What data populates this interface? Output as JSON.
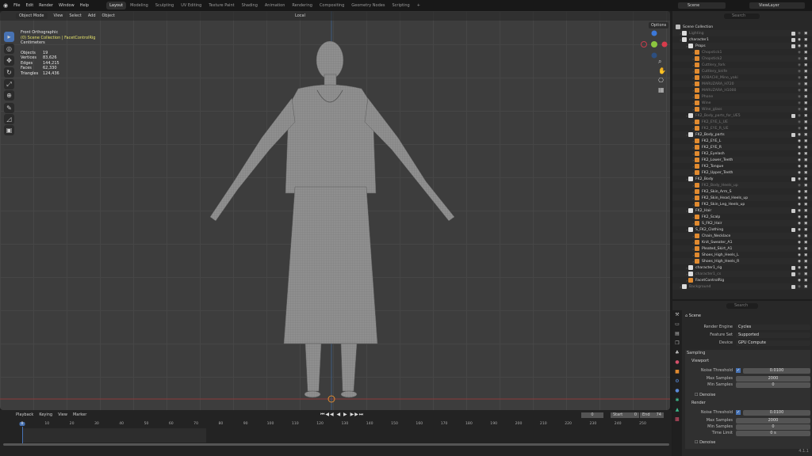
{
  "topbar": {
    "menus": [
      "File",
      "Edit",
      "Render",
      "Window",
      "Help"
    ],
    "workspaces": [
      "Layout",
      "Modeling",
      "Sculpting",
      "UV Editing",
      "Texture Paint",
      "Shading",
      "Animation",
      "Rendering",
      "Compositing",
      "Geometry Nodes",
      "Scripting",
      "+"
    ],
    "active_workspace": "Layout",
    "scene": "Scene",
    "view_layer": "ViewLayer"
  },
  "viewport": {
    "mode": "Object Mode",
    "menus": [
      "View",
      "Select",
      "Add",
      "Object"
    ],
    "transform": "Local",
    "options": "Options",
    "view_name": "Front Orthographic",
    "collection_path": "(0) Scene Collection | FacetControlRig",
    "units": "Centimeters",
    "stats": [
      {
        "label": "Objects",
        "value": "19"
      },
      {
        "label": "Vertices",
        "value": "83,626"
      },
      {
        "label": "Edges",
        "value": "144,215"
      },
      {
        "label": "Faces",
        "value": "62,330"
      },
      {
        "label": "Triangles",
        "value": "124,436"
      }
    ],
    "axes": {
      "x": "X",
      "y": "Y",
      "z": "Z"
    }
  },
  "outliner": {
    "search_placeholder": "Search",
    "rows": [
      {
        "name": "Scene Collection",
        "level": 0,
        "type": "scene",
        "dim": false
      },
      {
        "name": "Lighting",
        "level": 1,
        "type": "collection",
        "dim": true
      },
      {
        "name": "character1",
        "level": 1,
        "type": "collection",
        "dim": false
      },
      {
        "name": "Props",
        "level": 2,
        "type": "collection",
        "dim": false
      },
      {
        "name": "Chopstick1",
        "level": 3,
        "type": "mesh",
        "dim": true
      },
      {
        "name": "Chopstick2",
        "level": 3,
        "type": "mesh",
        "dim": true
      },
      {
        "name": "Cuttlery_fork",
        "level": 3,
        "type": "mesh",
        "dim": true
      },
      {
        "name": "Cuttlery_knife",
        "level": 3,
        "type": "mesh",
        "dim": true
      },
      {
        "name": "KOBACHI_Mino_yaki",
        "level": 3,
        "type": "mesh",
        "dim": true
      },
      {
        "name": "MARUZARA_H720",
        "level": 3,
        "type": "mesh",
        "dim": true
      },
      {
        "name": "MARUZARA_H1000",
        "level": 3,
        "type": "mesh",
        "dim": true
      },
      {
        "name": "Phone",
        "level": 3,
        "type": "mesh",
        "dim": true
      },
      {
        "name": "Wine",
        "level": 3,
        "type": "mesh",
        "dim": true
      },
      {
        "name": "Wine_glass",
        "level": 3,
        "type": "mesh",
        "dim": true
      },
      {
        "name": "FK2_Body_parts_for_UE5",
        "level": 2,
        "type": "collection",
        "dim": true
      },
      {
        "name": "FK2_EYE_L_UE",
        "level": 3,
        "type": "mesh",
        "dim": true
      },
      {
        "name": "FK2_EYE_R_UE",
        "level": 3,
        "type": "mesh",
        "dim": true
      },
      {
        "name": "FK2_Body_parts",
        "level": 2,
        "type": "collection",
        "dim": false
      },
      {
        "name": "FK2_EYE_L",
        "level": 3,
        "type": "mesh",
        "dim": false
      },
      {
        "name": "FK2_EYE_R",
        "level": 3,
        "type": "mesh",
        "dim": false
      },
      {
        "name": "FK2_Eyelash",
        "level": 3,
        "type": "mesh",
        "dim": false
      },
      {
        "name": "FK2_Lower_Teeth",
        "level": 3,
        "type": "mesh",
        "dim": false
      },
      {
        "name": "FK2_Tongue",
        "level": 3,
        "type": "mesh",
        "dim": false
      },
      {
        "name": "FK2_Upper_Teeth",
        "level": 3,
        "type": "mesh",
        "dim": false
      },
      {
        "name": "FK2_Body",
        "level": 2,
        "type": "collection",
        "dim": false
      },
      {
        "name": "FK2_Body_Heels_up",
        "level": 3,
        "type": "mesh",
        "dim": true
      },
      {
        "name": "FK2_Skin_Arm_S",
        "level": 3,
        "type": "mesh",
        "dim": false
      },
      {
        "name": "FK2_Skin_Head_Heels_up",
        "level": 3,
        "type": "mesh",
        "dim": false
      },
      {
        "name": "FK2_Skin_Leg_Heels_up",
        "level": 3,
        "type": "mesh",
        "dim": false
      },
      {
        "name": "FK2_Hair",
        "level": 2,
        "type": "collection",
        "dim": false
      },
      {
        "name": "FK2_Scalp",
        "level": 3,
        "type": "mesh",
        "dim": false
      },
      {
        "name": "S_FK2_Hair",
        "level": 3,
        "type": "mesh",
        "dim": false
      },
      {
        "name": "S_FK2_Clothing",
        "level": 2,
        "type": "collection",
        "dim": false
      },
      {
        "name": "Chain_Necklace",
        "level": 3,
        "type": "mesh",
        "dim": false
      },
      {
        "name": "Knit_Sweater_A1",
        "level": 3,
        "type": "mesh",
        "dim": false
      },
      {
        "name": "Pleated_Skirt_A1",
        "level": 3,
        "type": "mesh",
        "dim": false
      },
      {
        "name": "Shoes_High_Heels_L",
        "level": 3,
        "type": "mesh",
        "dim": false
      },
      {
        "name": "Shoes_High_Heels_R",
        "level": 3,
        "type": "mesh",
        "dim": false
      },
      {
        "name": "character1_rig",
        "level": 2,
        "type": "collection",
        "dim": false
      },
      {
        "name": "character1_cs",
        "level": 2,
        "type": "collection",
        "dim": true
      },
      {
        "name": "FacetControlRig",
        "level": 2,
        "type": "armature",
        "dim": false
      },
      {
        "name": "Background",
        "level": 1,
        "type": "collection",
        "dim": true
      }
    ]
  },
  "properties": {
    "search_placeholder": "Search",
    "context": "Scene",
    "render_engine": {
      "label": "Render Engine",
      "value": "Cycles"
    },
    "feature_set": {
      "label": "Feature Set",
      "value": "Supported"
    },
    "device": {
      "label": "Device",
      "value": "GPU Compute"
    },
    "sampling": "Sampling",
    "viewport": "Viewport",
    "render": "Render",
    "denoise": "Denoise",
    "vp_noise": {
      "label": "Noise Threshold",
      "value": "0.0100"
    },
    "vp_max": {
      "label": "Max Samples",
      "value": "2000"
    },
    "vp_min": {
      "label": "Min Samples",
      "value": "0"
    },
    "r_noise": {
      "label": "Noise Threshold",
      "value": "0.0100"
    },
    "r_max": {
      "label": "Max Samples",
      "value": "2000"
    },
    "r_min": {
      "label": "Min Samples",
      "value": "0"
    },
    "r_time": {
      "label": "Time Limit",
      "value": "0 s"
    },
    "version": "4.1.1"
  },
  "timeline": {
    "menus": [
      "Playback",
      "Keying",
      "View",
      "Marker"
    ],
    "current_frame": "0",
    "start_label": "Start",
    "start": "0",
    "end_label": "End",
    "end": "74",
    "ticks": [
      0,
      10,
      20,
      30,
      40,
      50,
      60,
      70,
      80,
      90,
      100,
      110,
      120,
      130,
      140,
      150,
      160,
      170,
      180,
      190,
      200,
      210,
      220,
      230,
      240,
      250
    ],
    "frame_end_value": 74,
    "playhead": 0
  }
}
